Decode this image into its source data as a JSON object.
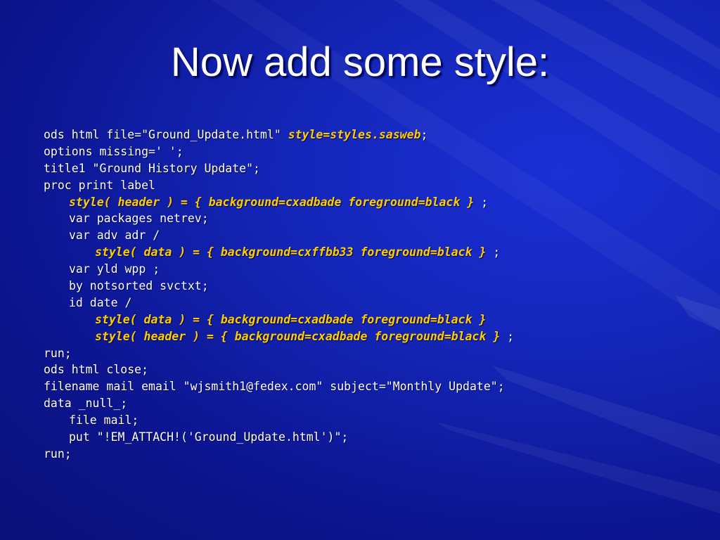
{
  "slide": {
    "title": "Now add some style:",
    "code": {
      "l1_a": "ods html file=\"Ground_Update.html\" ",
      "l1_hl": "style=styles.sasweb",
      "l1_b": ";",
      "l2": "options missing=' ';",
      "l3": "title1 \"Ground History Update\";",
      "l4": "proc print label",
      "l5_hl": "style( header ) = { background=cxadbade foreground=black }",
      "l5_b": " ;",
      "l6": "var packages netrev;",
      "l7": "var adv adr /",
      "l8_hl": "style( data ) = { background=cxffbb33 foreground=black }",
      "l8_b": " ;",
      "l9": "var yld wpp ;",
      "l10": "by notsorted svctxt;",
      "l11": "id date /",
      "l12_hl": "style( data ) = { background=cxadbade foreground=black }",
      "l13_hl": "style( header ) = { background=cxadbade foreground=black }",
      "l13_b": " ;",
      "l14": "run;",
      "l15": "ods html close;",
      "l16": "filename mail email \"wjsmith1@fedex.com\" subject=\"Monthly Update\";",
      "l17": "data _null_;",
      "l18": "file mail;",
      "l19": "put \"!EM_ATTACH!('Ground_Update.html')\";",
      "l20": "run;"
    }
  },
  "colors": {
    "background": "#1426b8",
    "text": "#ffffff",
    "highlight": "#ffcc00"
  }
}
